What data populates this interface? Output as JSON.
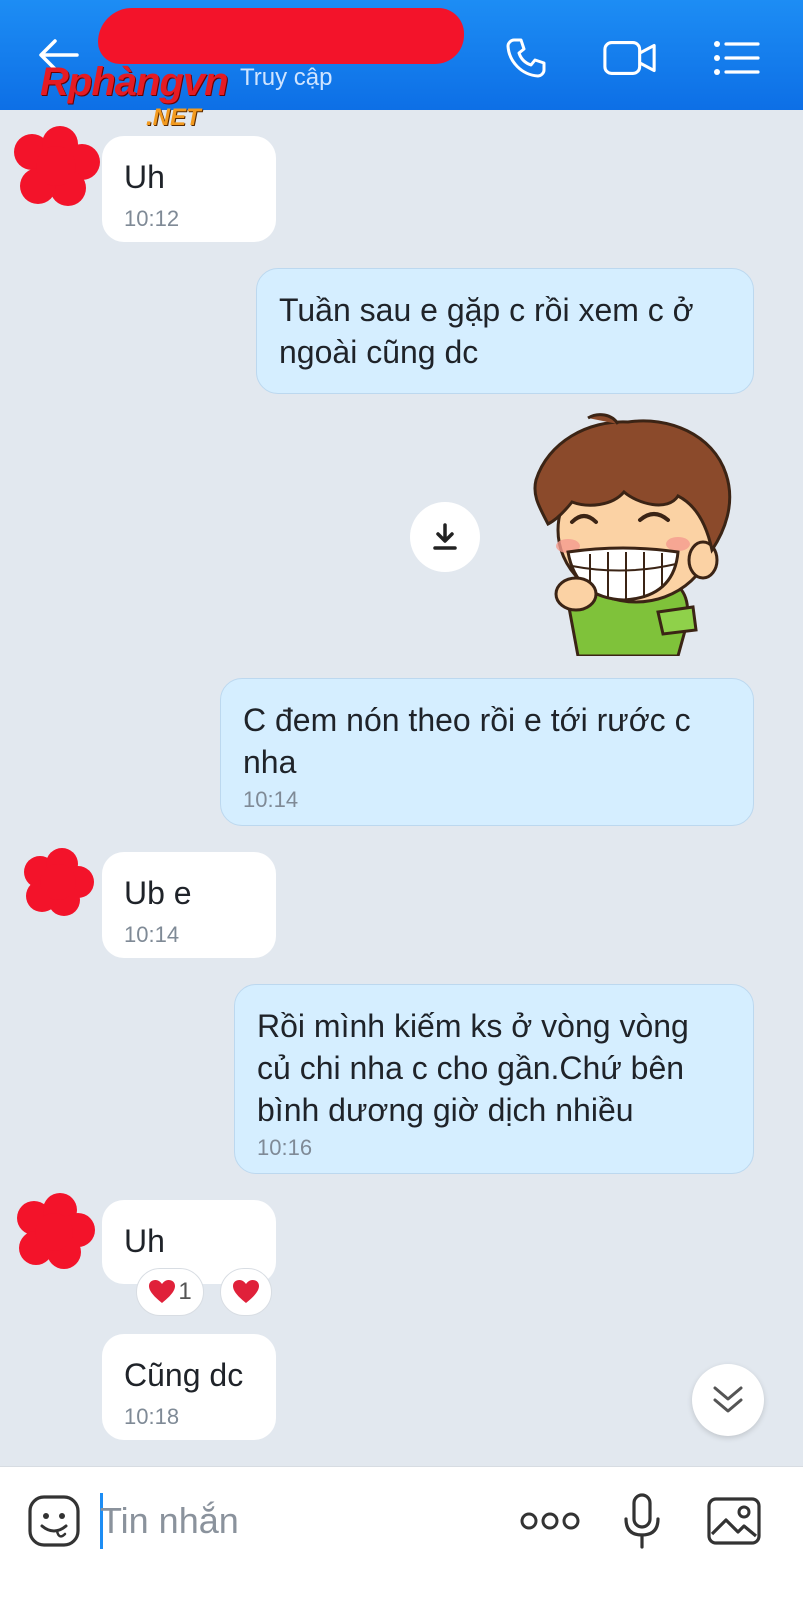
{
  "header": {
    "subtitle": "Truy cập",
    "watermark_main": "Rphàngvn",
    "watermark_suffix": ".NET",
    "accent_color": "#1d8df4"
  },
  "messages": [
    {
      "side": "in",
      "text": "Uh",
      "time": "10:12"
    },
    {
      "side": "out",
      "line1": "Tuần sau e gặp c rồi xem c ở",
      "line2": "ngoài cũng dc"
    },
    {
      "side": "out",
      "type": "sticker",
      "icon": "grinning-boy-sticker"
    },
    {
      "side": "out",
      "line1": "C đem nón theo rồi e tới rước c",
      "line2": "nha",
      "time": "10:14"
    },
    {
      "side": "in",
      "text": "Ub e",
      "time": "10:14"
    },
    {
      "side": "out",
      "line1": "Rồi mình kiếm ks ở vòng vòng",
      "line2": "củ chi nha c cho gần.Chứ bên",
      "line3": "bình dương giờ dịch nhiều",
      "time": "10:16"
    },
    {
      "side": "in",
      "text": "Uh",
      "reaction_count": "1"
    },
    {
      "side": "in",
      "text": "Cũng dc",
      "time": "10:18"
    }
  ],
  "input": {
    "placeholder": "Tin nhắn"
  },
  "icons": {
    "back": "back-arrow-icon",
    "call": "phone-icon",
    "video": "video-camera-icon",
    "menu": "list-menu-icon",
    "emoji": "emoji-icon",
    "more": "more-dots-icon",
    "mic": "microphone-icon",
    "image": "image-icon",
    "download": "download-icon",
    "scroll": "double-chevron-down-icon",
    "heart": "heart-icon"
  },
  "colors": {
    "header_bg": "#0d6fe6",
    "incoming_bubble": "#ffffff",
    "outgoing_bubble": "#d5eeff",
    "redaction": "#f3132a"
  }
}
